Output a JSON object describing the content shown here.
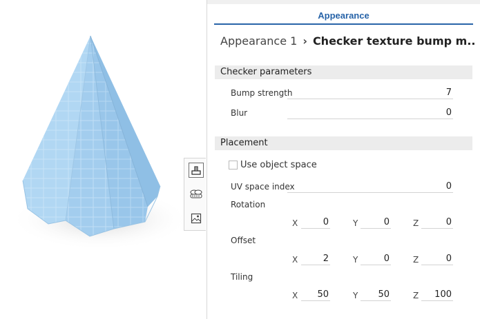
{
  "panel": {
    "title": "Appearance",
    "breadcrumb": {
      "parent": "Appearance 1",
      "separator": "›",
      "current": "Checker texture bump m..."
    }
  },
  "checker": {
    "header": "Checker parameters",
    "bump_strength": {
      "label": "Bump strength",
      "value": "7"
    },
    "blur": {
      "label": "Blur",
      "value": "0"
    }
  },
  "placement": {
    "header": "Placement",
    "use_object_space": {
      "label": "Use object space",
      "checked": false
    },
    "uv_space_index": {
      "label": "UV space index",
      "value": "0"
    },
    "rotation": {
      "label": "Rotation",
      "x": "0",
      "y": "0",
      "z": "0"
    },
    "offset": {
      "label": "Offset",
      "x": "2",
      "y": "0",
      "z": "0"
    },
    "tiling": {
      "label": "Tiling",
      "x": "50",
      "y": "50",
      "z": "100"
    },
    "axis_labels": {
      "x": "X",
      "y": "Y",
      "z": "Z"
    }
  },
  "icons": {
    "toolbar": [
      "appearance-panel-icon",
      "texture-stack-icon",
      "image-texture-icon"
    ],
    "breadcrumb": "appearance-swatch-icon"
  },
  "colors": {
    "accent": "#2763a8",
    "model_fill": "#a9d2f0"
  }
}
